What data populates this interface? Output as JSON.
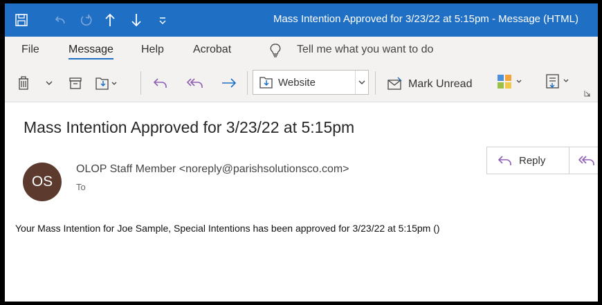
{
  "window": {
    "title": "Mass Intention Approved for 3/23/22 at 5:15pm  -  Message (HTML)",
    "quick_access": [
      "save-icon",
      "undo-icon",
      "redo-icon",
      "previous-item-icon",
      "next-item-icon",
      "customize-toolbar-icon"
    ]
  },
  "menu": {
    "file": "File",
    "message": "Message",
    "help": "Help",
    "acrobat": "Acrobat",
    "tell_me": "Tell me what you want to do",
    "active": "Message"
  },
  "ribbon": {
    "move_to_folder": "Website",
    "mark_unread": "Mark Unread",
    "icons": [
      "delete-icon",
      "archive-icon",
      "move-icon",
      "reply-icon",
      "reply-all-icon",
      "forward-icon",
      "mark-unread-icon",
      "categorize-icon",
      "follow-up-icon"
    ]
  },
  "message": {
    "subject": "Mass Intention Approved for 3/23/22 at 5:15pm",
    "avatar_initials": "OS",
    "sender": "OLOP Staff Member <noreply@parishsolutionsco.com>",
    "to_label": "To",
    "reply_label": "Reply",
    "body": "Your Mass Intention for Joe Sample, Special Intentions has been approved for 3/23/22 at 5:15pm ()"
  },
  "colors": {
    "titlebar": "#1f6fc5",
    "accent": "#1f6fc5",
    "avatar": "#5c3b2e",
    "reply_arrow": "#8e5fb5"
  }
}
